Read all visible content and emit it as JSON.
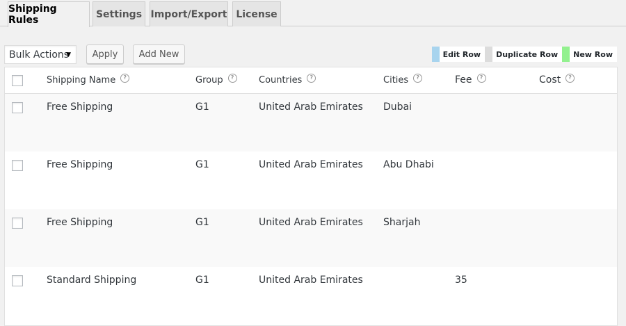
{
  "tabs": [
    {
      "label": "Shipping Rules",
      "active": true
    },
    {
      "label": "Settings",
      "active": false
    },
    {
      "label": "Import/Export",
      "active": false
    },
    {
      "label": "License",
      "active": false
    }
  ],
  "toolbar": {
    "bulk_actions": "Bulk Actions",
    "apply_label": "Apply",
    "add_new_label": "Add New"
  },
  "legend": [
    {
      "label": "Edit Row",
      "color": "#a8d4ee"
    },
    {
      "label": "Duplicate Row",
      "color": "#dcdcdc"
    },
    {
      "label": "New Row",
      "color": "#93f18f"
    }
  ],
  "table": {
    "columns": [
      "Shipping Name",
      "Group",
      "Countries",
      "Cities",
      "Fee",
      "Cost"
    ],
    "help_glyph": "?",
    "rows": [
      {
        "name": "Free Shipping",
        "group": "G1",
        "country": "United Arab Emirates",
        "city": "Dubai",
        "fee": "",
        "cost": ""
      },
      {
        "name": "Free Shipping",
        "group": "G1",
        "country": "United Arab Emirates",
        "city": "Abu Dhabi",
        "fee": "",
        "cost": ""
      },
      {
        "name": "Free Shipping",
        "group": "G1",
        "country": "United Arab Emirates",
        "city": "Sharjah",
        "fee": "",
        "cost": ""
      },
      {
        "name": "Standard Shipping",
        "group": "G1",
        "country": "United Arab Emirates",
        "city": "",
        "fee": "35",
        "cost": ""
      }
    ]
  }
}
